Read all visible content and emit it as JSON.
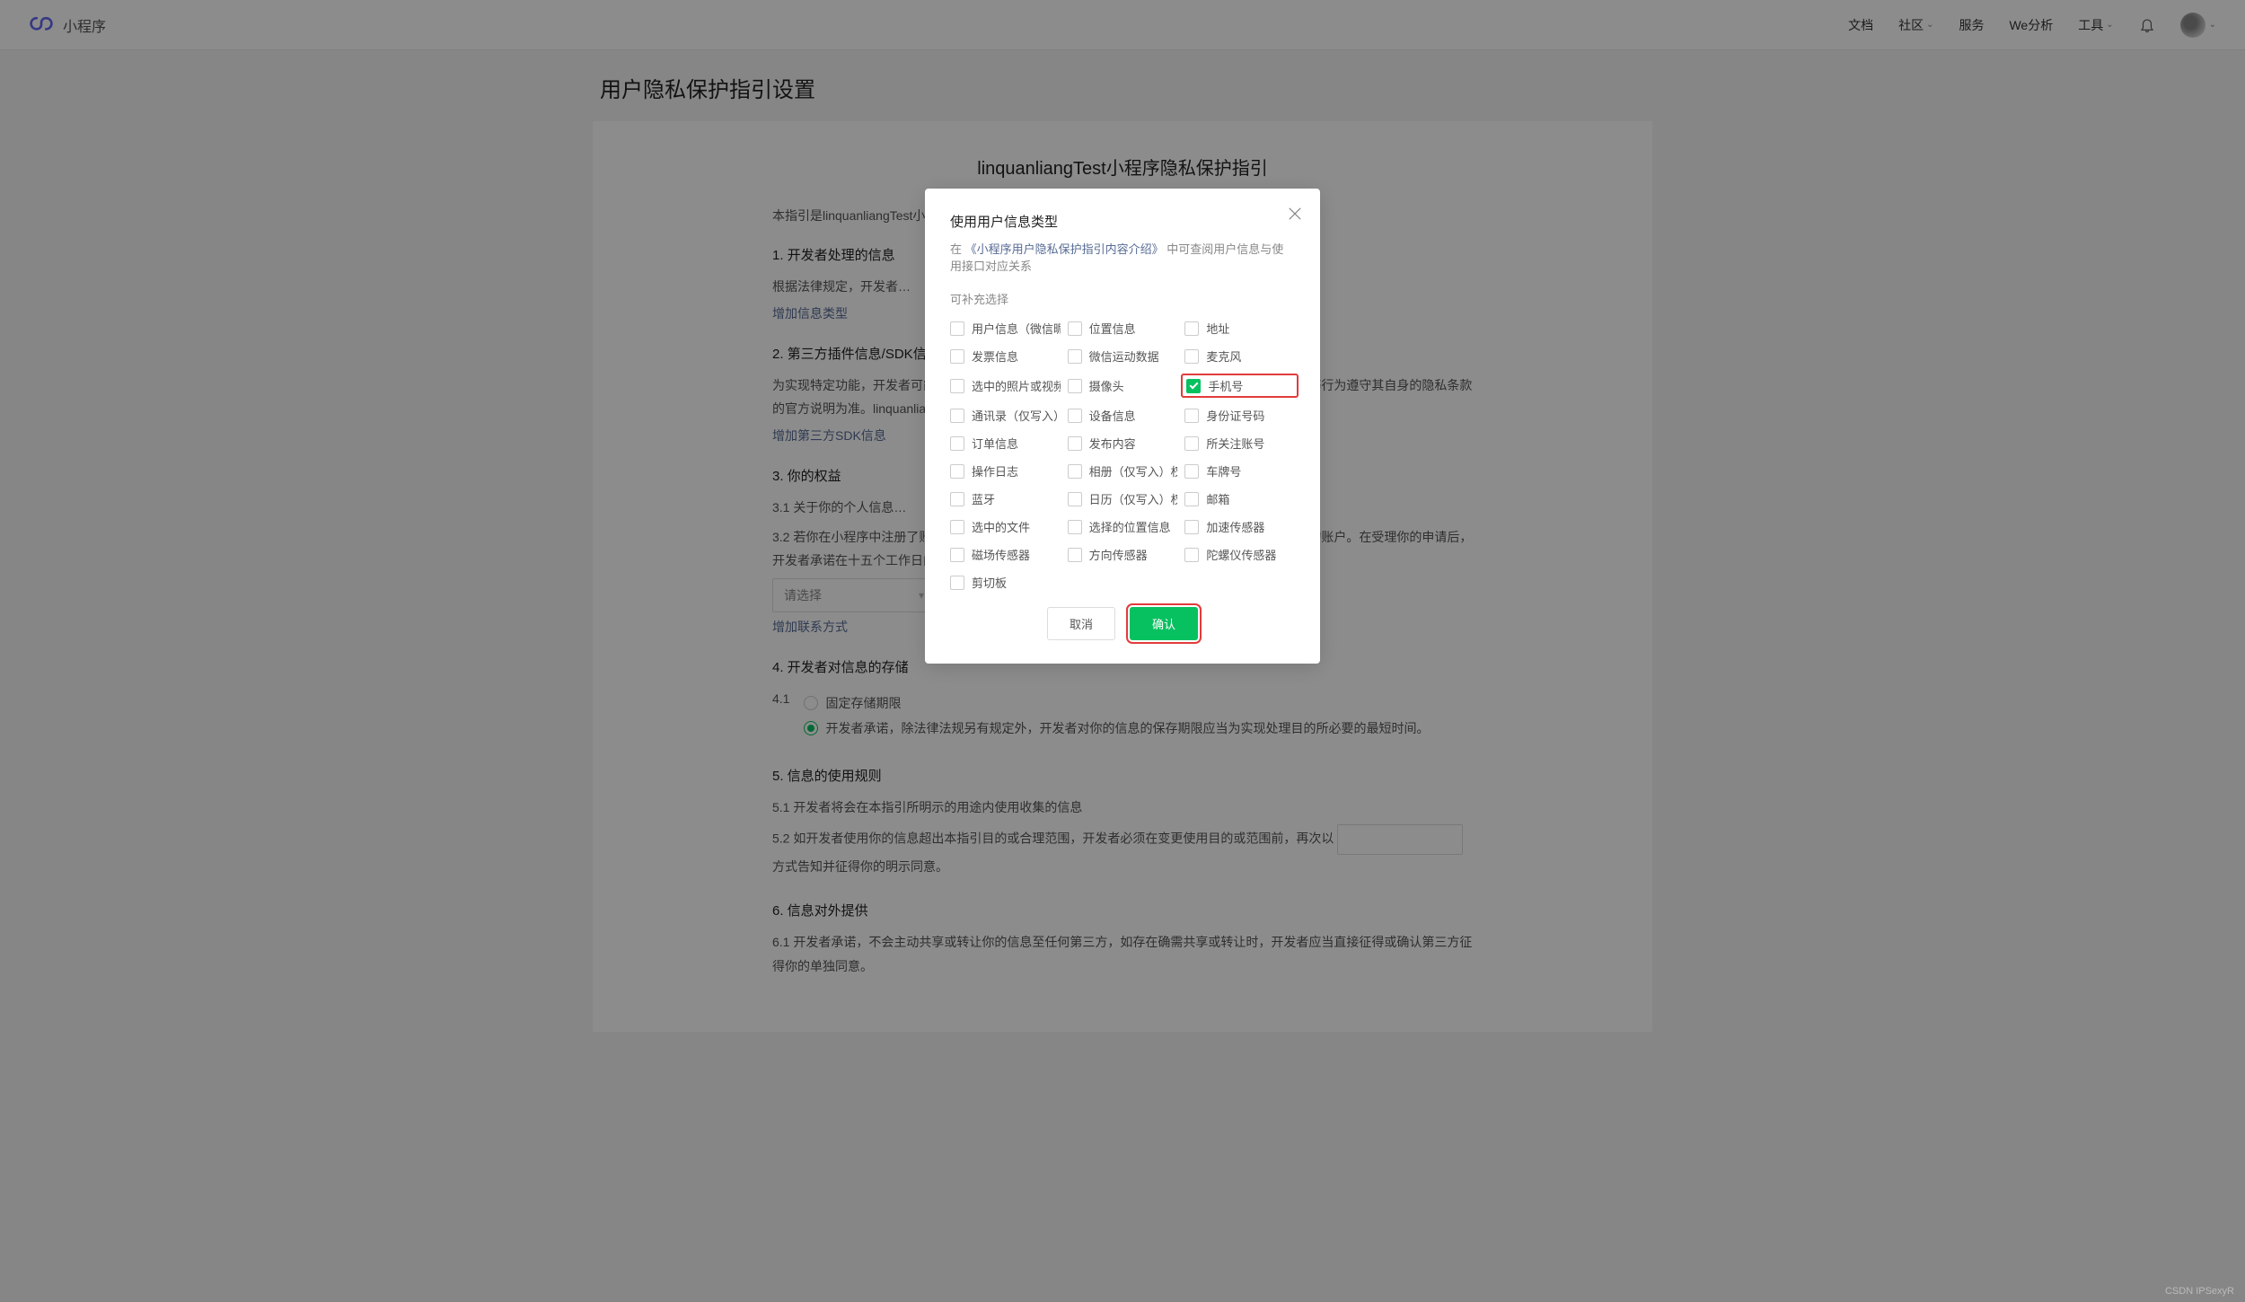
{
  "header": {
    "brand": "小程序",
    "nav": [
      "文档",
      "社区",
      "服务",
      "We分析",
      "工具"
    ],
    "navHasDropdown": [
      false,
      true,
      false,
      false,
      true
    ]
  },
  "page": {
    "title": "用户隐私保护指引设置",
    "docTitle": "linquanliangTest小程序隐私保护指引",
    "intro": "本指引是linquanliangTest小程序开发者 （以下简称\"开发者\"）为处理你的个人信息而制定。",
    "sections": {
      "s1": {
        "heading": "1.  开发者处理的信息",
        "body": "根据法律规定，开发者…",
        "action": "增加信息类型"
      },
      "s2": {
        "heading": "2.  第三方插件信息/SDK信息",
        "body": "为实现特定功能，开发者可能会接入由第三方提供的插件/SDK。第三方插件/SDK收集和处理信息等行为遵守其自身的隐私条款的官方说明为准。linquanliangTest小程序接入的第三方插件信息/SDK信息如下：",
        "action": "增加第三方SDK信息"
      },
      "s3": {
        "heading": "3.  你的权益",
        "sub1": "3.1  关于你的个人信息…",
        "sub2": "3.2  若你在小程序中注册了账户，你可以通过以下方式与开发者联系，申请注销你在小程序中使用的账户。在受理你的申请后，开发者承诺在十五个工作日内完成核查和处理。",
        "selectPlaceholder": "请选择",
        "action": "增加联系方式"
      },
      "s4": {
        "heading": "4.  开发者对信息的存储",
        "sub1_prefix": "4.1",
        "radio1": "固定存储期限",
        "radio2": "开发者承诺，除法律法规另有规定外，开发者对你的信息的保存期限应当为实现处理目的所必要的最短时间。",
        "radioSelected": 1
      },
      "s5": {
        "heading": "5.  信息的使用规则",
        "sub1": "5.1  开发者将会在本指引所明示的用途内使用收集的信息",
        "sub2_a": "5.2  如开发者使用你的信息超出本指引目的或合理范围，开发者必须在变更使用目的或范围前，再次以",
        "sub2_b": "方式告知并征得你的明示同意。"
      },
      "s6": {
        "heading": "6.  信息对外提供",
        "sub1": "6.1  开发者承诺，不会主动共享或转让你的信息至任何第三方，如存在确需共享或转让时，开发者应当直接征得或确认第三方征得你的单独同意。"
      }
    }
  },
  "modal": {
    "title": "使用用户信息类型",
    "subPrefix": "在",
    "subLink": "《小程序用户隐私保护指引内容介绍》",
    "subSuffix": "中可查阅用户信息与使用接口对应关系",
    "sectionLabel": "可补充选择",
    "options": [
      {
        "label": "用户信息（微信昵…",
        "checked": false
      },
      {
        "label": "位置信息",
        "checked": false
      },
      {
        "label": "地址",
        "checked": false
      },
      {
        "label": "发票信息",
        "checked": false
      },
      {
        "label": "微信运动数据",
        "checked": false
      },
      {
        "label": "麦克风",
        "checked": false
      },
      {
        "label": "选中的照片或视频…",
        "checked": false
      },
      {
        "label": "摄像头",
        "checked": false
      },
      {
        "label": "手机号",
        "checked": true,
        "highlight": true
      },
      {
        "label": "通讯录（仅写入）…",
        "checked": false
      },
      {
        "label": "设备信息",
        "checked": false
      },
      {
        "label": "身份证号码",
        "checked": false
      },
      {
        "label": "订单信息",
        "checked": false
      },
      {
        "label": "发布内容",
        "checked": false
      },
      {
        "label": "所关注账号",
        "checked": false
      },
      {
        "label": "操作日志",
        "checked": false
      },
      {
        "label": "相册（仅写入）权限",
        "checked": false
      },
      {
        "label": "车牌号",
        "checked": false
      },
      {
        "label": "蓝牙",
        "checked": false
      },
      {
        "label": "日历（仅写入）权限",
        "checked": false
      },
      {
        "label": "邮箱",
        "checked": false
      },
      {
        "label": "选中的文件",
        "checked": false
      },
      {
        "label": "选择的位置信息",
        "checked": false
      },
      {
        "label": "加速传感器",
        "checked": false
      },
      {
        "label": "磁场传感器",
        "checked": false
      },
      {
        "label": "方向传感器",
        "checked": false
      },
      {
        "label": "陀螺仪传感器",
        "checked": false
      },
      {
        "label": "剪切板",
        "checked": false
      }
    ],
    "cancel": "取消",
    "confirm": "确认"
  },
  "watermark": "CSDN IPSexyR"
}
